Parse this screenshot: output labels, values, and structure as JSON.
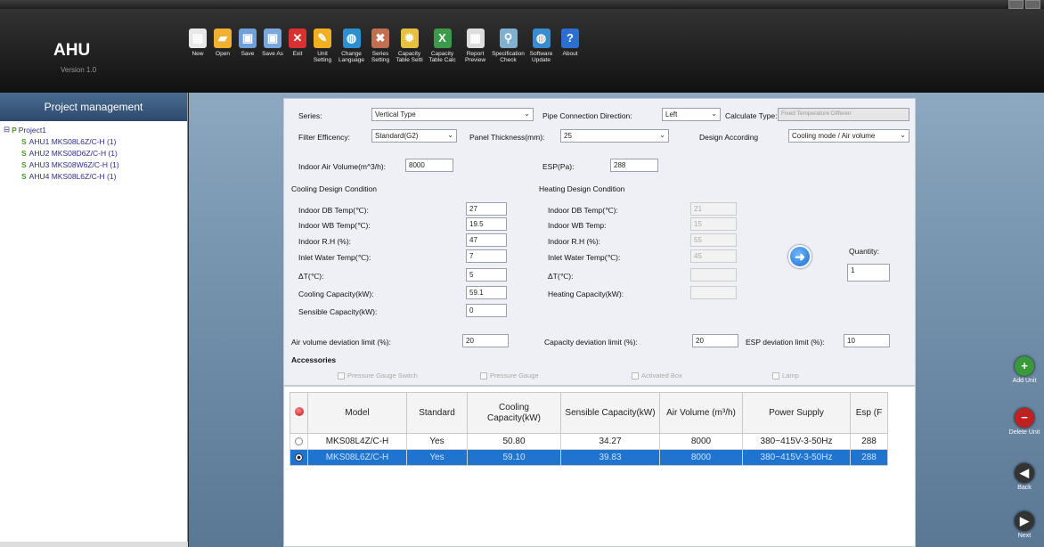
{
  "app": {
    "title": "AHU",
    "version": "Version 1.0"
  },
  "toolbar": [
    {
      "label": "New",
      "icon": "new-file-icon",
      "color": "#e8e8e8"
    },
    {
      "label": "Open",
      "icon": "open-folder-icon",
      "color": "#f0b030"
    },
    {
      "label": "Save",
      "icon": "save-disk-icon",
      "color": "#6fa0d8"
    },
    {
      "label": "Save As",
      "icon": "save-as-icon",
      "color": "#7aa8dc"
    },
    {
      "label": "Exit",
      "icon": "exit-icon",
      "color": "#d93030"
    },
    {
      "label": "Unit Setting",
      "icon": "pencil-icon",
      "color": "#f0b020"
    },
    {
      "label": "Change Language",
      "icon": "globe-icon",
      "color": "#2e8fcf",
      "wide": true
    },
    {
      "label": "Series Setting",
      "icon": "tools-icon",
      "color": "#c07050"
    },
    {
      "label": "Capacity Table Setti",
      "icon": "gear-icon",
      "color": "#e8c040",
      "wide": true
    },
    {
      "label": "Capacity Table Calc",
      "icon": "excel-icon",
      "color": "#3c9a4a",
      "wide": true
    },
    {
      "label": "Report Preview",
      "icon": "printer-icon",
      "color": "#dddddd",
      "wide": true
    },
    {
      "label": "Specification Check",
      "icon": "magnifier-icon",
      "color": "#80b0d0",
      "wide": true
    },
    {
      "label": "Software Update",
      "icon": "update-globe-icon",
      "color": "#3a8ccf",
      "wide": true
    },
    {
      "label": "About",
      "icon": "help-icon",
      "color": "#2c6fd0"
    }
  ],
  "project_panel": {
    "title": "Project management",
    "root": "Project1",
    "units": [
      "AHU1 MKS08L6Z/C-H (1)",
      "AHU2 MKS08D6Z/C-H (1)",
      "AHU3 MKS08W6Z/C-H (1)",
      "AHU4 MKS08L6Z/C-H (1)"
    ]
  },
  "form": {
    "series_label": "Series:",
    "series_value": "Vertical Type",
    "pipe_dir_label": "Pipe Connection Direction:",
    "pipe_dir_value": "Left",
    "calc_type_label": "Calculate Type:",
    "calc_type_value": "Fixed Temperature Differen",
    "filter_label": "Filter Efficency:",
    "filter_value": "Standard(G2)",
    "panel_label": "Panel Thickness(mm):",
    "panel_value": "25",
    "design_label": "Design According",
    "design_value": "Cooling mode / Air volume",
    "air_volume_label": "Indoor Air Volume(m^3/h):",
    "air_volume_value": "8000",
    "esp_label": "ESP(Pa):",
    "esp_value": "288",
    "cooling_title": "Cooling Design Condition",
    "cooling": [
      {
        "label": "Indoor DB Temp(℃):",
        "value": "27"
      },
      {
        "label": "Indoor WB Temp(℃):",
        "value": "19.5"
      },
      {
        "label": "Indoor R.H (%):",
        "value": "47"
      },
      {
        "label": "Inlet Water Temp(℃):",
        "value": "7"
      },
      {
        "label": "ΔT(℃):",
        "value": "5"
      },
      {
        "label": "Cooling Capacity(kW):",
        "value": "59.1"
      },
      {
        "label": "Sensible Capacity(kW):",
        "value": "0"
      }
    ],
    "heating_title": "Heating Design Condition",
    "heating": [
      {
        "label": "Indoor DB Temp(℃):",
        "value": "21"
      },
      {
        "label": "Indoor WB Temp:",
        "value": "15"
      },
      {
        "label": "Indoor R.H (%):",
        "value": "55"
      },
      {
        "label": "Inlet Water Temp(℃):",
        "value": "45"
      },
      {
        "label": "ΔT(℃):",
        "value": ""
      },
      {
        "label": "Heating Capacity(kW):",
        "value": ""
      }
    ],
    "quantity_label": "Quantity:",
    "quantity_value": "1",
    "air_dev_label": "Air volume deviation limit (%):",
    "air_dev_value": "20",
    "cap_dev_label": "Capacity deviation limit (%):",
    "cap_dev_value": "20",
    "esp_dev_label": "ESP deviation limit (%):",
    "esp_dev_value": "10",
    "accessories_label": "Accessories",
    "accessories": [
      "Pressure Gauge Switch",
      "Pressure Gauge",
      "Activated Box",
      "Lamp"
    ]
  },
  "results": {
    "headers": [
      "Model",
      "Standard",
      "Cooling Capacity(kW)",
      "Sensible Capacity(kW)",
      "Air Volume (m³/h)",
      "Power Supply",
      "Esp (F"
    ],
    "rows": [
      {
        "model": "MKS08L4Z/C-H",
        "standard": "Yes",
        "cooling": "50.80",
        "sensible": "34.27",
        "air": "8000",
        "power": "380~415V-3-50Hz",
        "esp": "288",
        "selected": false
      },
      {
        "model": "MKS08L6Z/C-H",
        "standard": "Yes",
        "cooling": "59.10",
        "sensible": "39.83",
        "air": "8000",
        "power": "380~415V-3-50Hz",
        "esp": "288",
        "selected": true
      }
    ]
  },
  "side_buttons": [
    {
      "label": "Add Unit",
      "icon": "add-icon",
      "color": "#3a9a3a"
    },
    {
      "label": "Delete Unit",
      "icon": "delete-icon",
      "color": "#c02020"
    },
    {
      "label": "Back",
      "icon": "back-icon",
      "color": "#333333"
    },
    {
      "label": "Next",
      "icon": "next-icon",
      "color": "#333333"
    }
  ],
  "colors": {
    "selection": "#1e74cf",
    "panel_header": "#3a5a80"
  }
}
